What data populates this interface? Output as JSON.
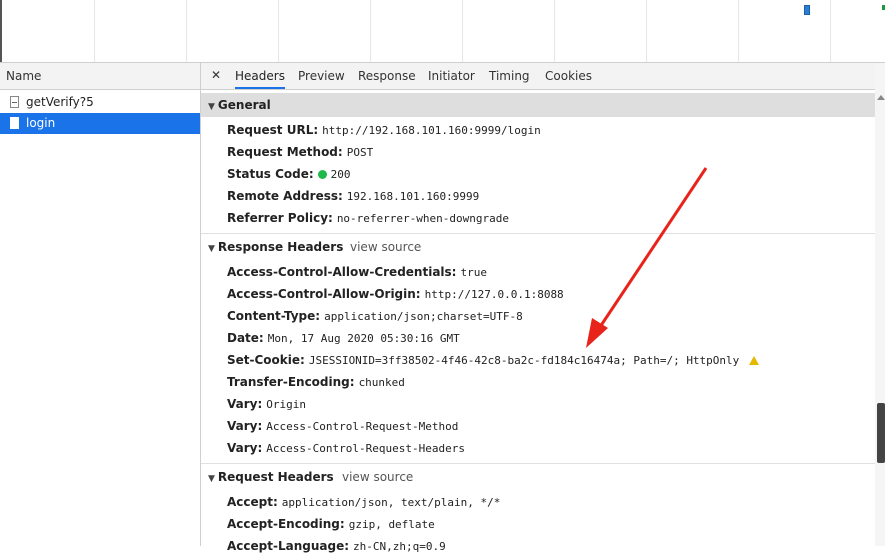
{
  "names": {
    "header": "Name",
    "requests": [
      "getVerify?5",
      "login"
    ]
  },
  "tabs": [
    "Headers",
    "Preview",
    "Response",
    "Initiator",
    "Timing",
    "Cookies"
  ],
  "general": {
    "title": "General",
    "rows": [
      {
        "k": "Request URL:",
        "v": "http://192.168.101.160:9999/login"
      },
      {
        "k": "Request Method:",
        "v": "POST"
      },
      {
        "k": "Status Code:",
        "v": "200"
      },
      {
        "k": "Remote Address:",
        "v": "192.168.101.160:9999"
      },
      {
        "k": "Referrer Policy:",
        "v": "no-referrer-when-downgrade"
      }
    ]
  },
  "response_headers": {
    "title": "Response Headers",
    "view_source": "view source",
    "rows": [
      {
        "k": "Access-Control-Allow-Credentials:",
        "v": "true"
      },
      {
        "k": "Access-Control-Allow-Origin:",
        "v": "http://127.0.0.1:8088"
      },
      {
        "k": "Content-Type:",
        "v": "application/json;charset=UTF-8"
      },
      {
        "k": "Date:",
        "v": "Mon, 17 Aug 2020 05:30:16 GMT"
      },
      {
        "k": "Set-Cookie:",
        "v": "JSESSIONID=3ff38502-4f46-42c8-ba2c-fd184c16474a; Path=/; HttpOnly"
      },
      {
        "k": "Transfer-Encoding:",
        "v": "chunked"
      },
      {
        "k": "Vary:",
        "v": "Origin"
      },
      {
        "k": "Vary:",
        "v": "Access-Control-Request-Method"
      },
      {
        "k": "Vary:",
        "v": "Access-Control-Request-Headers"
      }
    ]
  },
  "request_headers": {
    "title": "Request Headers",
    "view_source": "view source",
    "rows": [
      {
        "k": "Accept:",
        "v": "application/json, text/plain, */*"
      },
      {
        "k": "Accept-Encoding:",
        "v": "gzip, deflate"
      },
      {
        "k": "Accept-Language:",
        "v": "zh-CN,zh;q=0.9"
      }
    ]
  },
  "colors": {
    "accent": "#1a73e8",
    "status_ok": "#1fb84a",
    "warning": "#e6b800",
    "arrow": "#e8231b"
  }
}
